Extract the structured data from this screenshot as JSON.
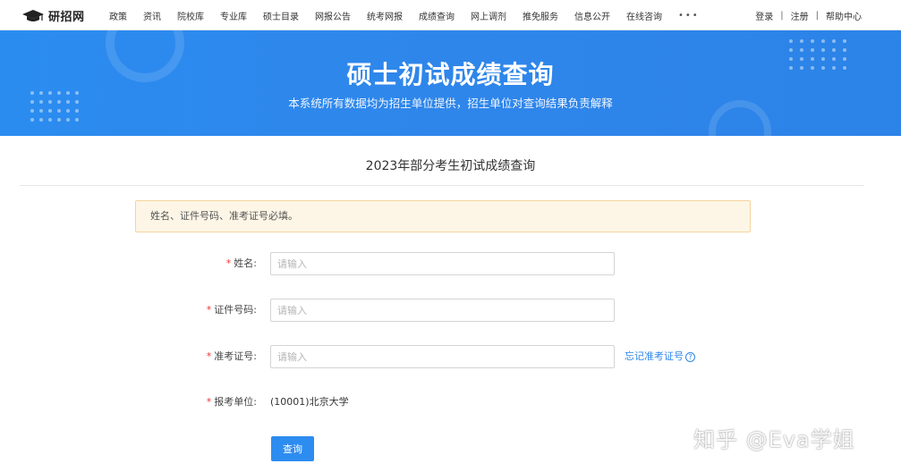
{
  "header": {
    "logo_text": "研招网",
    "nav": [
      "政策",
      "资讯",
      "院校库",
      "专业库",
      "硕士目录",
      "网报公告",
      "统考网报",
      "成绩查询",
      "网上调剂",
      "推免服务",
      "信息公开",
      "在线咨询"
    ],
    "more": "•••",
    "login": "登录",
    "register": "注册",
    "help": "帮助中心",
    "separator": "|"
  },
  "banner": {
    "title": "硕士初试成绩查询",
    "subtitle": "本系统所有数据均为招生单位提供，招生单位对查询结果负责解释"
  },
  "main": {
    "heading": "2023年部分考生初试成绩查询",
    "notice": "姓名、证件号码、准考证号必填。",
    "required_mark": "*",
    "fields": {
      "name": {
        "label": "姓名:",
        "placeholder": "请输入"
      },
      "id_number": {
        "label": "证件号码:",
        "placeholder": "请输入"
      },
      "exam_number": {
        "label": "准考证号:",
        "placeholder": "请输入",
        "forgot": "忘记准考证号",
        "help_icon": "?"
      },
      "institution": {
        "label": "报考单位:",
        "value": "(10001)北京大学"
      }
    },
    "submit": "查询"
  },
  "watermark": "知乎 @Eva学姐",
  "colors": {
    "primary": "#2d8cf0",
    "required": "#ee3333",
    "notice_bg": "#fdf6e6"
  }
}
